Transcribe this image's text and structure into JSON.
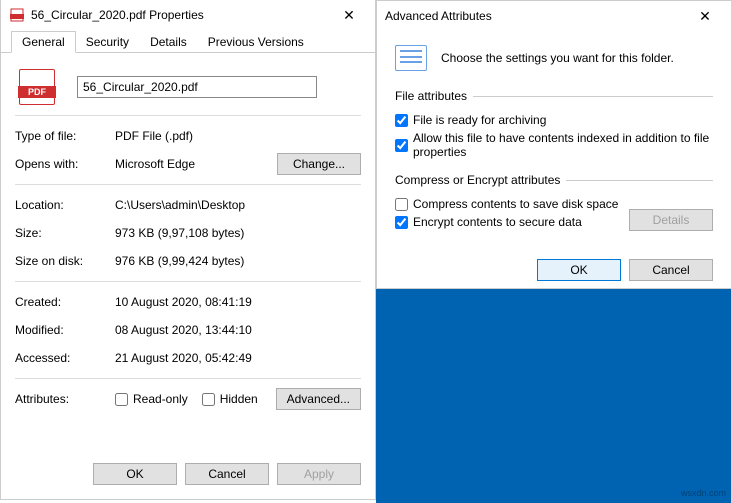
{
  "properties": {
    "title": "56_Circular_2020.pdf Properties",
    "tabs": {
      "general": "General",
      "security": "Security",
      "details": "Details",
      "previous": "Previous Versions"
    },
    "filename": "56_Circular_2020.pdf",
    "labels": {
      "typeOfFile": "Type of file:",
      "opensWith": "Opens with:",
      "location": "Location:",
      "size": "Size:",
      "sizeOnDisk": "Size on disk:",
      "created": "Created:",
      "modified": "Modified:",
      "accessed": "Accessed:",
      "attributes": "Attributes:"
    },
    "values": {
      "typeOfFile": "PDF File (.pdf)",
      "opensWith": "Microsoft Edge",
      "location": "C:\\Users\\admin\\Desktop",
      "size": "973 KB (9,97,108 bytes)",
      "sizeOnDisk": "976 KB (9,99,424 bytes)",
      "created": "10 August 2020, 08:41:19",
      "modified": "08 August 2020, 13:44:10",
      "accessed": "21 August 2020, 05:42:49"
    },
    "checkboxes": {
      "readonly": "Read-only",
      "hidden": "Hidden"
    },
    "buttons": {
      "change": "Change...",
      "advanced": "Advanced...",
      "ok": "OK",
      "cancel": "Cancel",
      "apply": "Apply"
    }
  },
  "advanced": {
    "title": "Advanced Attributes",
    "intro": "Choose the settings you want for this folder.",
    "fileAttrLegend": "File attributes",
    "fileAttr": {
      "archive": "File is ready for archiving",
      "index": "Allow this file to have contents indexed in addition to file properties"
    },
    "encryptLegend": "Compress or Encrypt attributes",
    "encrypt": {
      "compress": "Compress contents to save disk space",
      "encrypt": "Encrypt contents to secure data"
    },
    "buttons": {
      "details": "Details",
      "ok": "OK",
      "cancel": "Cancel"
    }
  },
  "watermark": "wsxdn.com"
}
